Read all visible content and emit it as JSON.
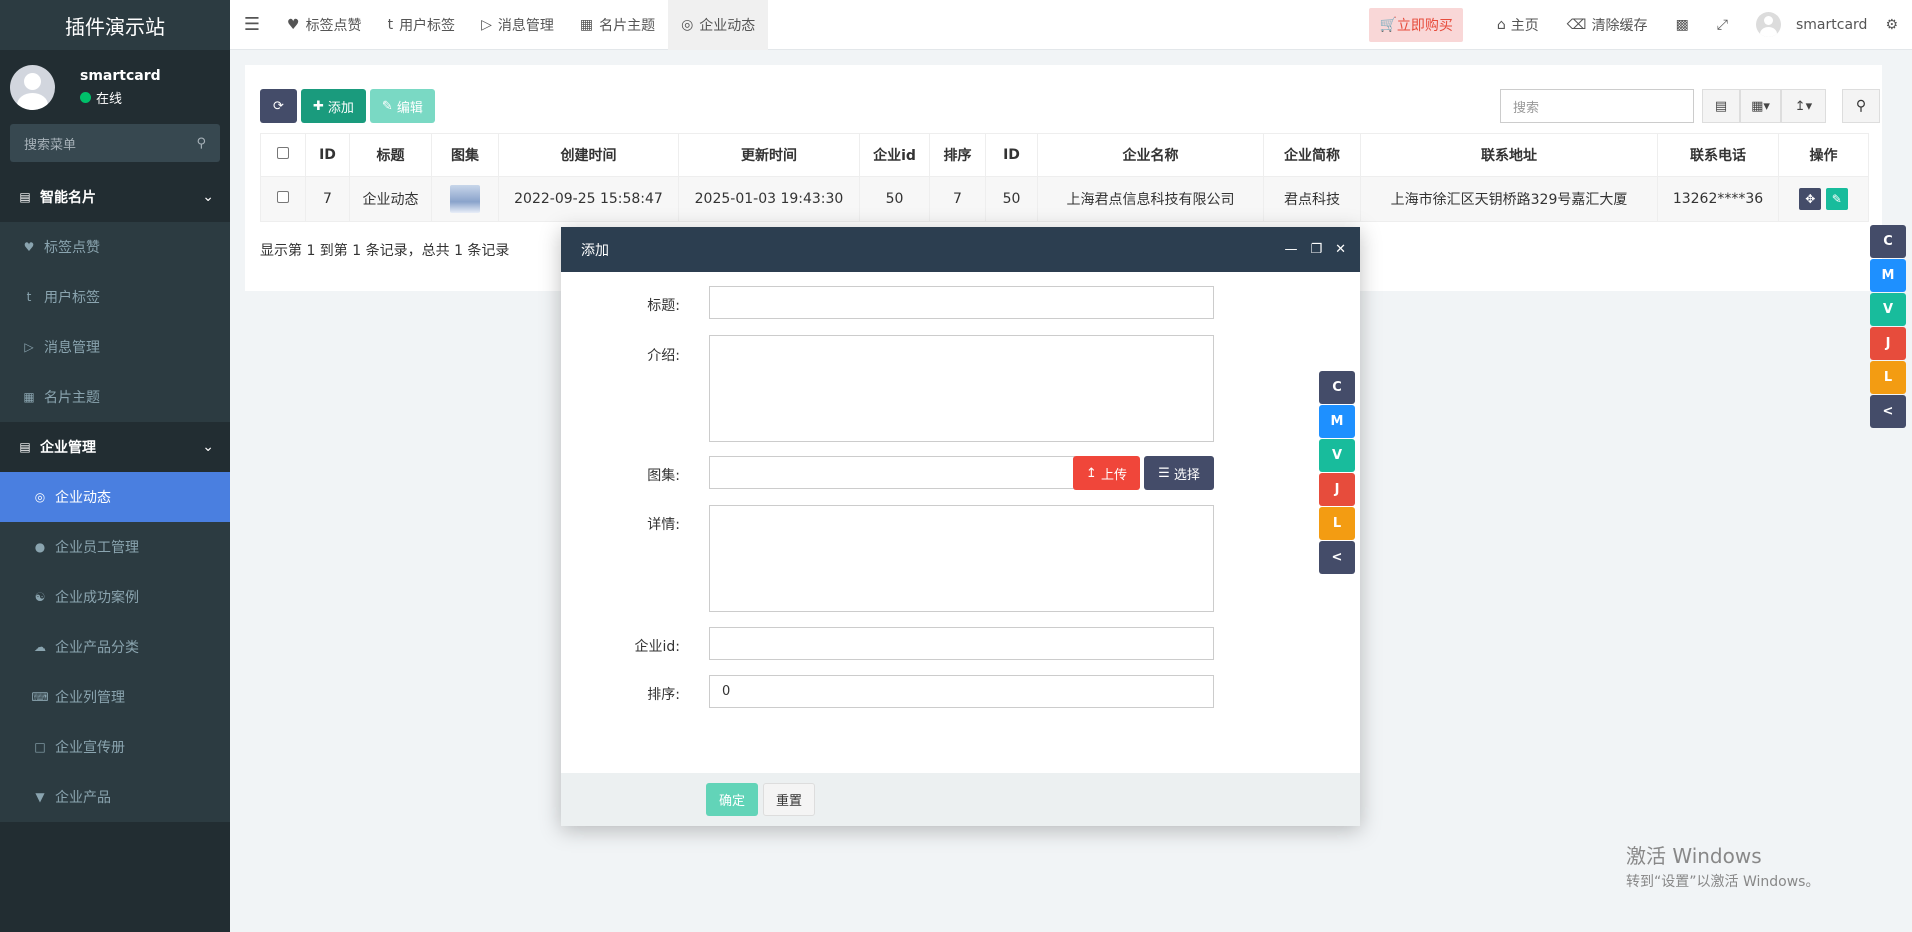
{
  "app": {
    "title": "插件演示站"
  },
  "user": {
    "name": "smartcard",
    "status": "在线"
  },
  "sidebar": {
    "search_placeholder": "搜索菜单",
    "groups": [
      {
        "label": "智能名片",
        "items": [
          "标签点赞",
          "用户标签",
          "消息管理",
          "名片主题"
        ]
      },
      {
        "label": "企业管理",
        "items": [
          "企业动态",
          "企业员工管理",
          "企业成功案例",
          "企业产品分类",
          "企业列管理",
          "企业宣传册",
          "企业产品"
        ]
      }
    ]
  },
  "topbar": {
    "tabs": [
      "标签点赞",
      "用户标签",
      "消息管理",
      "名片主题",
      "企业动态"
    ],
    "buy": "立即购买",
    "home": "主页",
    "clear_cache": "清除缓存",
    "username": "smartcard"
  },
  "toolbar": {
    "add": "添加",
    "edit": "编辑",
    "search_placeholder": "搜索"
  },
  "table": {
    "headers": [
      "ID",
      "标题",
      "图集",
      "创建时间",
      "更新时间",
      "企业id",
      "排序",
      "ID",
      "企业名称",
      "企业简称",
      "联系地址",
      "联系电话",
      "操作"
    ],
    "rows": [
      [
        "7",
        "企业动态",
        "",
        "2022-09-25 15:58:47",
        "2025-01-03 19:43:30",
        "50",
        "7",
        "50",
        "上海君点信息科技有限公司",
        "君点科技",
        "上海市徐汇区天钥桥路329号嘉汇大厦",
        "13262****36"
      ]
    ],
    "pager": "显示第 1 到第 1 条记录，总共 1 条记录"
  },
  "badges": [
    "C",
    "M",
    "V",
    "J",
    "L",
    "<"
  ],
  "modal": {
    "title": "添加",
    "fields": {
      "title_label": "标题:",
      "intro_label": "介绍:",
      "gallery_label": "图集:",
      "detail_label": "详情:",
      "company_label": "企业id:",
      "sort_label": "排序:",
      "sort_value": "0"
    },
    "upload": "上传",
    "choose": "选择",
    "ok": "确定",
    "reset": "重置"
  },
  "watermark": {
    "line1": "激活 Windows",
    "line2": "转到“设置”以激活 Windows。"
  },
  "colors": {
    "sidebar_bg": "#222d32",
    "active": "#4a7fe0",
    "modal_head": "#2c3e50"
  }
}
